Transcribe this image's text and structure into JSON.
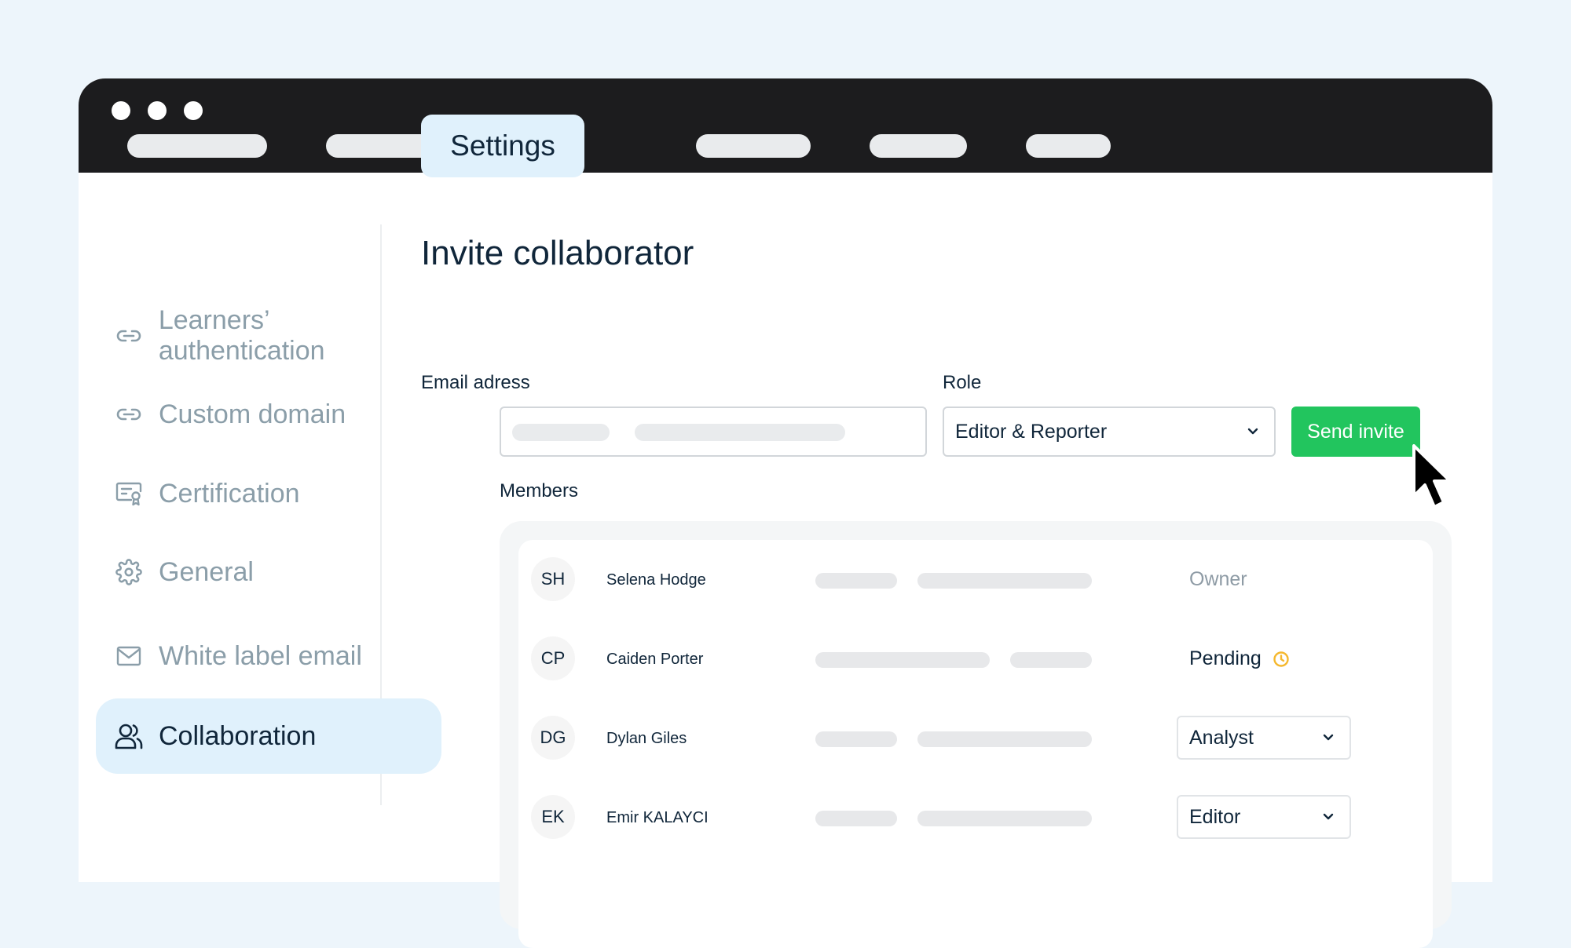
{
  "top_nav": {
    "active_tab": "Settings"
  },
  "sidebar": {
    "items": [
      {
        "label": "Learners’ authentication",
        "icon": "link-icon"
      },
      {
        "label": "Custom domain",
        "icon": "link-icon"
      },
      {
        "label": "Certification",
        "icon": "certificate-icon"
      },
      {
        "label": "General",
        "icon": "gear-icon"
      },
      {
        "label": "White label email",
        "icon": "mail-icon"
      },
      {
        "label": "Collaboration",
        "icon": "users-icon",
        "active": true
      }
    ]
  },
  "invite": {
    "title": "Invite collaborator",
    "email_label": "Email adress",
    "role_label": "Role",
    "role_value": "Editor & Reporter",
    "send_label": "Send invite"
  },
  "members": {
    "label": "Members",
    "rows": [
      {
        "initials": "SH",
        "name": "Selena Hodge",
        "status": "Owner"
      },
      {
        "initials": "CP",
        "name": "Caiden Porter",
        "status": "Pending"
      },
      {
        "initials": "DG",
        "name": "Dylan Giles",
        "role": "Analyst"
      },
      {
        "initials": "EK",
        "name": "Emir KALAYCI",
        "role": "Editor"
      }
    ]
  },
  "colors": {
    "accent_green": "#22c55e",
    "active_bg": "#e0f1fc",
    "titlebar": "#1c1c1e",
    "pending_icon": "#f5b82e"
  }
}
